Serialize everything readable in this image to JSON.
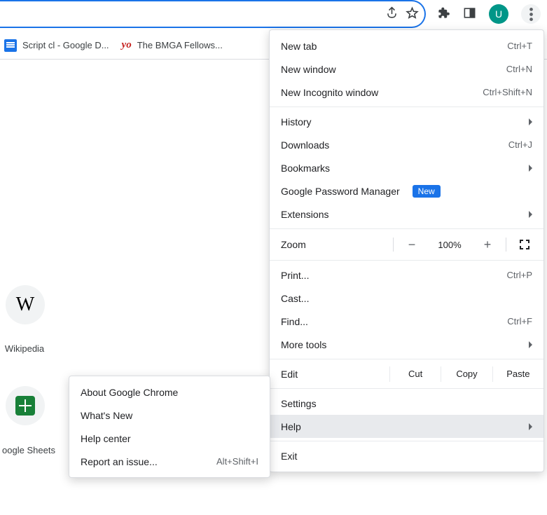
{
  "urlbar": {
    "value": ""
  },
  "avatar": {
    "letter": "U"
  },
  "bookmarks": [
    {
      "icon": "docs",
      "label": "Script cl - Google D..."
    },
    {
      "icon": "yo",
      "label": "The BMGA Fellows..."
    }
  ],
  "tiles": [
    {
      "id": "wikipedia",
      "label": "Wikipedia"
    },
    {
      "id": "google-sheets",
      "label": "oogle Sheets"
    }
  ],
  "menu": {
    "new_tab": {
      "label": "New tab",
      "shortcut": "Ctrl+T"
    },
    "new_win": {
      "label": "New window",
      "shortcut": "Ctrl+N"
    },
    "incognito": {
      "label": "New Incognito window",
      "shortcut": "Ctrl+Shift+N"
    },
    "history": {
      "label": "History"
    },
    "downloads": {
      "label": "Downloads",
      "shortcut": "Ctrl+J"
    },
    "bookmarks": {
      "label": "Bookmarks"
    },
    "passwords": {
      "label": "Google Password Manager",
      "badge": "New"
    },
    "extensions": {
      "label": "Extensions"
    },
    "zoom": {
      "label": "Zoom",
      "minus": "−",
      "value": "100%",
      "plus": "+"
    },
    "print": {
      "label": "Print...",
      "shortcut": "Ctrl+P"
    },
    "cast": {
      "label": "Cast..."
    },
    "find": {
      "label": "Find...",
      "shortcut": "Ctrl+F"
    },
    "more_tools": {
      "label": "More tools"
    },
    "edit": {
      "label": "Edit",
      "cut": "Cut",
      "copy": "Copy",
      "paste": "Paste"
    },
    "settings": {
      "label": "Settings"
    },
    "help": {
      "label": "Help"
    },
    "exit": {
      "label": "Exit"
    }
  },
  "help_menu": {
    "about": {
      "label": "About Google Chrome"
    },
    "whats": {
      "label": "What's New"
    },
    "center": {
      "label": "Help center"
    },
    "report": {
      "label": "Report an issue...",
      "shortcut": "Alt+Shift+I"
    }
  }
}
